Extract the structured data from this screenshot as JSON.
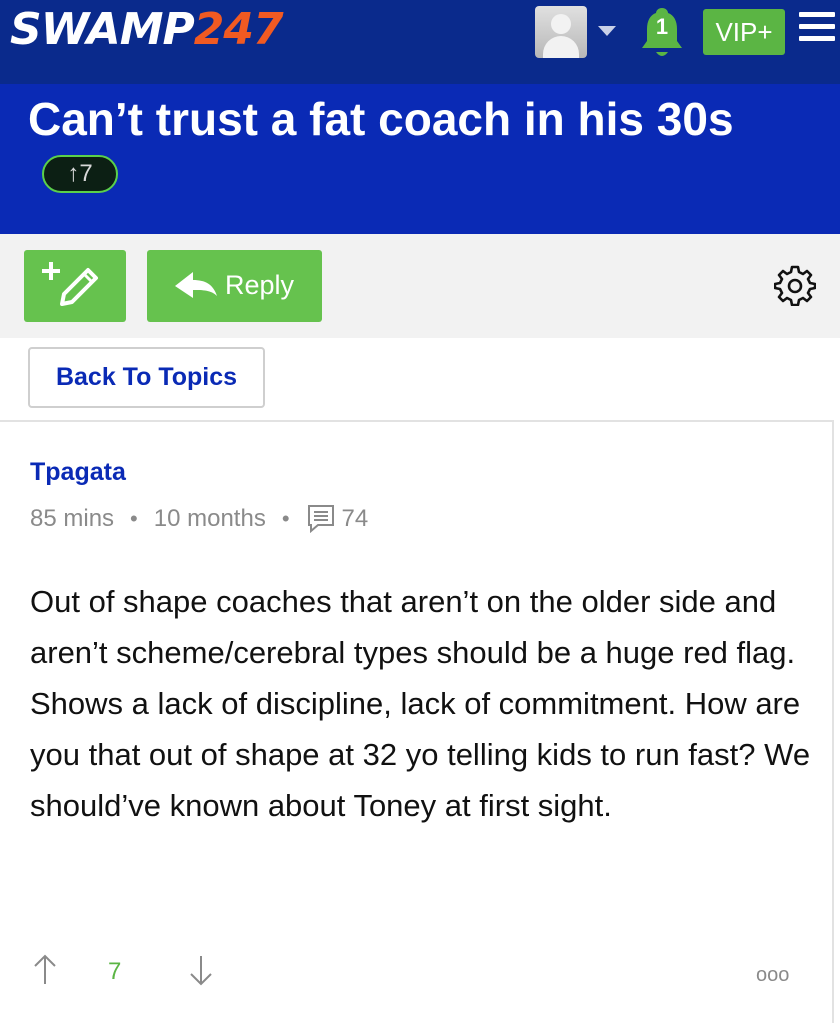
{
  "header": {
    "logo_prefix": "SWAMP",
    "logo_suffix": "247",
    "notification_count": "1",
    "vip_label": "VIP+",
    "colors": {
      "bar": "#0a2a8c",
      "accent_orange": "#f15a22",
      "green": "#5bb544"
    }
  },
  "topic": {
    "title": "Can’t trust a fat coach in his 30s",
    "vote_badge": "↑7"
  },
  "actions": {
    "reply_label": "Reply",
    "back_label": "Back To Topics"
  },
  "post": {
    "author": "Tpagata",
    "meta": {
      "time_ago": "85 mins",
      "member_since": "10 months",
      "comment_count": "74"
    },
    "body": "Out of shape coaches that aren’t on the older side and aren’t scheme/cerebral types should be a huge red flag. Shows a lack of discipline, lack of commitment. How are you that out of shape at 32 yo telling kids to run fast? We should’ve known about Toney at first sight.",
    "votes": "7",
    "more_label": "ooo"
  }
}
